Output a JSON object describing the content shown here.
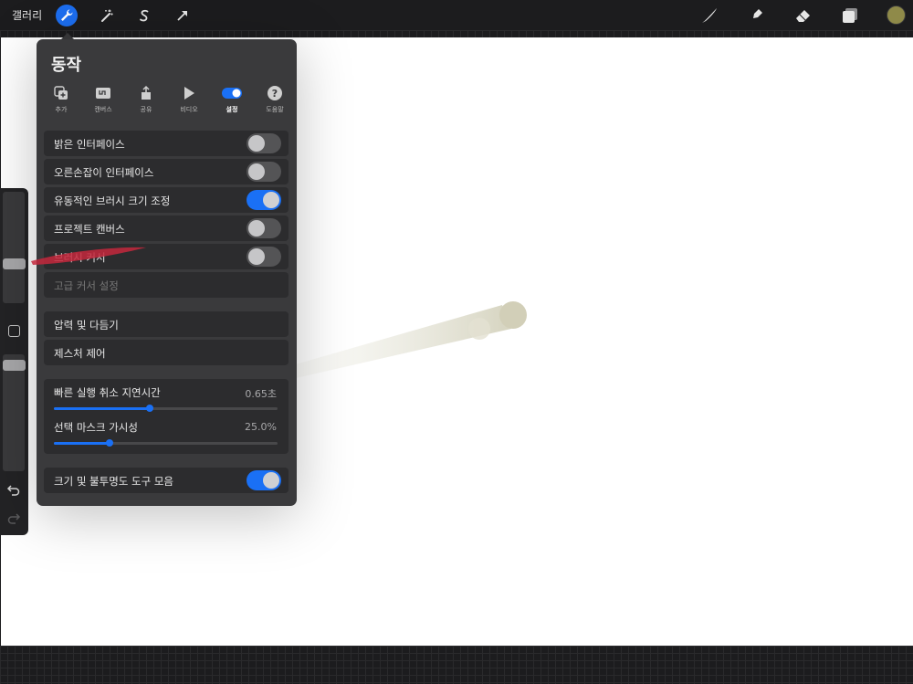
{
  "topbar": {
    "gallery_label": "갤러리",
    "left_tools": [
      "wrench-icon",
      "magic-wand-icon",
      "selection-icon",
      "transform-arrow-icon"
    ],
    "right_tools": [
      "brush-icon",
      "smudge-icon",
      "eraser-icon",
      "layers-icon"
    ],
    "color": "#8f8a49"
  },
  "panel": {
    "title": "동작",
    "tabs": [
      {
        "label": "추가",
        "icon": "add-icon"
      },
      {
        "label": "캔버스",
        "icon": "canvas-icon"
      },
      {
        "label": "공유",
        "icon": "share-icon"
      },
      {
        "label": "비디오",
        "icon": "video-play-icon"
      },
      {
        "label": "설정",
        "icon": "settings-toggle-icon",
        "active": true
      },
      {
        "label": "도움말",
        "icon": "help-icon"
      }
    ],
    "toggles": [
      {
        "label": "밝은 인터페이스",
        "on": false
      },
      {
        "label": "오른손잡이 인터페이스",
        "on": false
      },
      {
        "label": "유동적인 브러시 크기 조정",
        "on": true
      },
      {
        "label": "프로젝트 캔버스",
        "on": false
      },
      {
        "label": "브러시 커서",
        "on": false
      }
    ],
    "advanced_cursor": "고급 커서 설정",
    "pressure": "압력 및 다듬기",
    "gesture": "제스처 제어",
    "sliders": [
      {
        "label": "빠른 실행 취소 지연시간",
        "value_text": "0.65초",
        "fraction": 0.43
      },
      {
        "label": "선택 마스크 가시성",
        "value_text": "25.0%",
        "fraction": 0.25
      }
    ],
    "size_opacity": {
      "label": "크기 및 불투명도 도구 모음",
      "on": true
    }
  },
  "accent": "#1a70f5"
}
